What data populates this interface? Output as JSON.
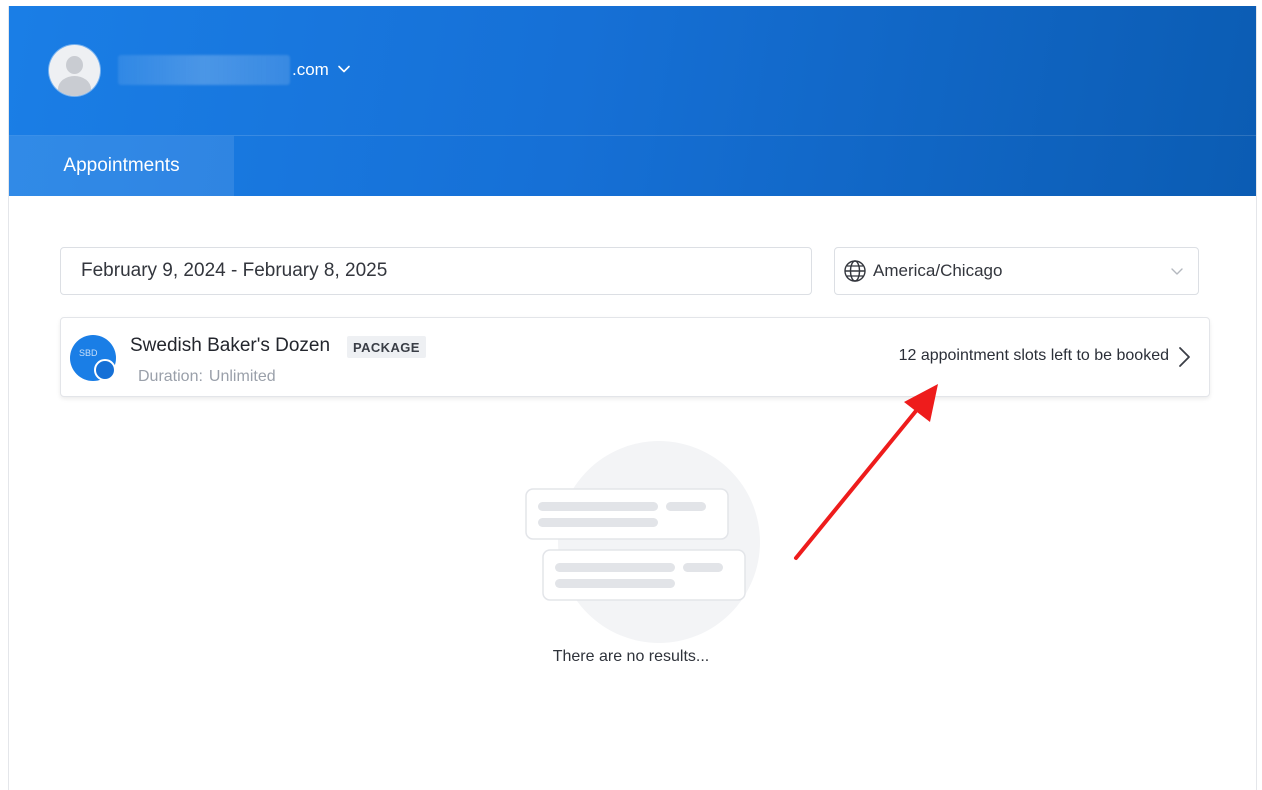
{
  "header": {
    "email_domain": ".com"
  },
  "tabs": [
    {
      "label": "Appointments",
      "active": true
    }
  ],
  "filters": {
    "date_range": "February 9, 2024 - February 8, 2025",
    "timezone": "America/Chicago"
  },
  "package": {
    "logo_initials": "SBD",
    "name": "Swedish Baker's Dozen",
    "badge": "PACKAGE",
    "duration_label": "Duration:",
    "duration_value": "Unlimited",
    "slots_text": "12 appointment slots left to be booked"
  },
  "empty_state": {
    "message": "There are no results..."
  },
  "colors": {
    "brand_blue": "#1670d6",
    "annotation_red": "#ee1c1c"
  }
}
